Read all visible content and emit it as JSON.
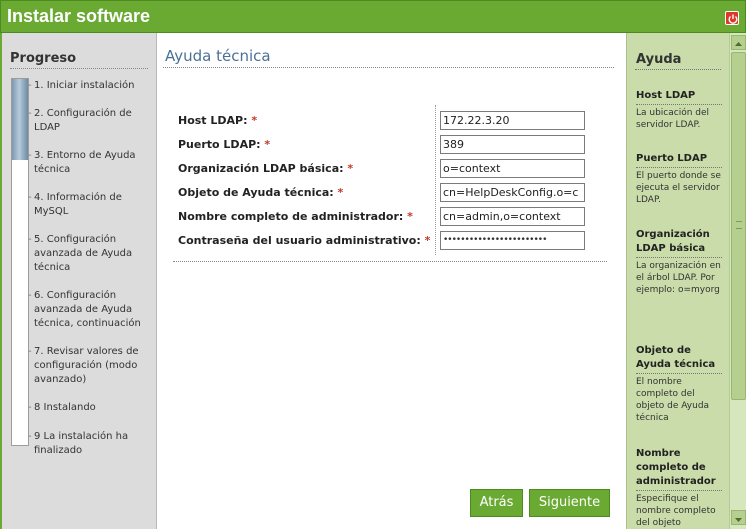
{
  "window": {
    "title": "Instalar software",
    "close_icon": "power-icon",
    "accent_color": "#6aaa33"
  },
  "sidebar": {
    "heading": "Progreso",
    "progress_fraction": 0.22,
    "steps": [
      "1. Iniciar instalación",
      "2. Configuración de LDAP",
      "3. Entorno de Ayuda técnica",
      "4. Información de MySQL",
      "5. Configuración avanzada de Ayuda técnica",
      "6. Configuración avanzada de Ayuda técnica, continuación",
      "7. Revisar valores de configuración (modo avanzado)",
      "8 Instalando",
      "9 La instalación ha finalizado"
    ]
  },
  "main": {
    "heading": "Ayuda técnica",
    "required_mark": "*",
    "fields": [
      {
        "label": "Host LDAP:",
        "value": "172.22.3.20"
      },
      {
        "label": "Puerto LDAP:",
        "value": "389"
      },
      {
        "label": "Organización LDAP básica:",
        "value": "o=context"
      },
      {
        "label": "Objeto de Ayuda técnica:",
        "value": "cn=HelpDeskConfig.o=c"
      },
      {
        "label": "Nombre completo de administrador:",
        "value": "cn=admin,o=context"
      },
      {
        "label": "Contraseña del usuario administrativo:",
        "value": "••••••••••••••••••••••••"
      }
    ],
    "back_label": "Atrás",
    "next_label": "Siguiente"
  },
  "help": {
    "heading": "Ayuda",
    "topics": [
      {
        "title": "Host LDAP",
        "text": "La ubicación del servidor LDAP."
      },
      {
        "title": "Puerto LDAP",
        "text": "El puerto donde se ejecuta el servidor LDAP."
      },
      {
        "title": "Organización LDAP básica",
        "text": "La organización en el árbol LDAP. Por ejemplo: o=myorg"
      },
      {
        "title": "Objeto de Ayuda técnica",
        "text": "El nombre completo del objeto de Ayuda técnica"
      },
      {
        "title": "Nombre completo de administrador",
        "text": "Especifique el nombre completo del objeto"
      }
    ]
  }
}
